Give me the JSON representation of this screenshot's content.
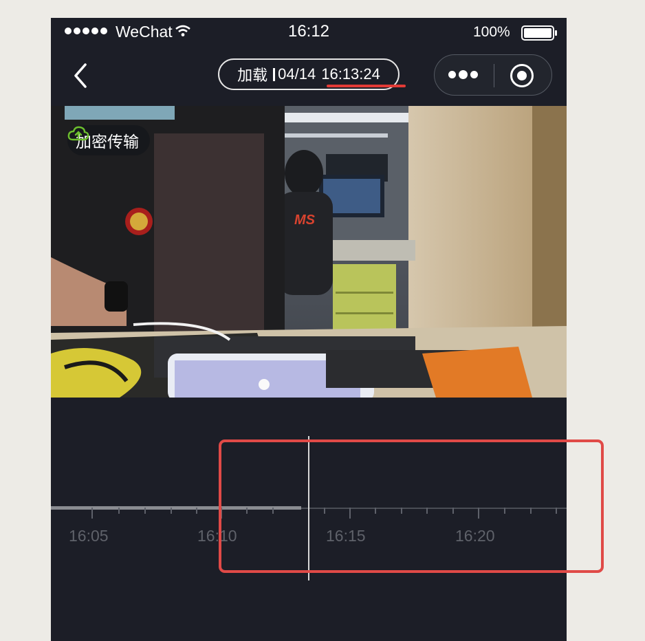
{
  "status_bar": {
    "carrier": "WeChat",
    "time": "16:12",
    "battery": "100%"
  },
  "nav": {
    "status_label": "加载",
    "date": "04/14",
    "playback_time": "16:13:24"
  },
  "video": {
    "badge_label": "加密传输"
  },
  "timeline": {
    "labels": [
      "16:05",
      "16:10",
      "16:15",
      "16:20"
    ],
    "current_time": "16:13:24"
  },
  "colors": {
    "highlight": "#e04a47",
    "underline": "#e33b36",
    "badge_icon": "#6dbf2e"
  }
}
